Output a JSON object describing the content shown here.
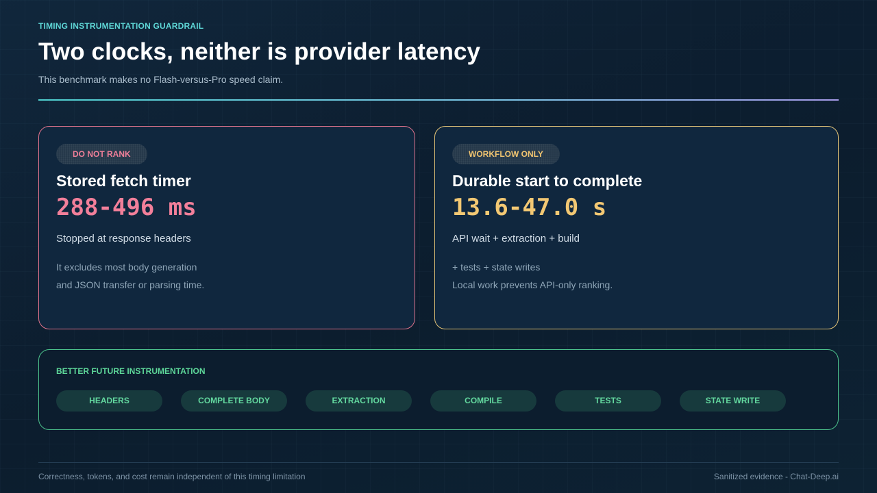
{
  "header": {
    "eyebrow": "TIMING INSTRUMENTATION GUARDRAIL",
    "title": "Two clocks, neither is provider latency",
    "subtitle": "This benchmark makes no Flash-versus-Pro speed claim."
  },
  "cards": [
    {
      "badge": "DO NOT RANK",
      "title": "Stored fetch timer",
      "value": "288-496 ms",
      "subtitle": "Stopped at response headers",
      "notes": [
        "It excludes most body generation",
        "and JSON transfer or parsing time."
      ],
      "accent": "#e0738c"
    },
    {
      "badge": "WORKFLOW ONLY",
      "title": "Durable start to complete",
      "value": "13.6-47.0 s",
      "subtitle": "API wait + extraction + build",
      "notes": [
        "+ tests + state writes",
        "Local work prevents API-only ranking."
      ],
      "accent": "#e2c277"
    }
  ],
  "instrumentation": {
    "label": "BETTER FUTURE INSTRUMENTATION",
    "chips": [
      "HEADERS",
      "COMPLETE BODY",
      "EXTRACTION",
      "COMPILE",
      "TESTS",
      "STATE WRITE"
    ],
    "accent": "#4cc28c"
  },
  "footer": {
    "left": "Correctness, tokens, and cost remain independent of this timing limitation",
    "right": "Sanitized evidence - Chat-Deep.ai"
  }
}
